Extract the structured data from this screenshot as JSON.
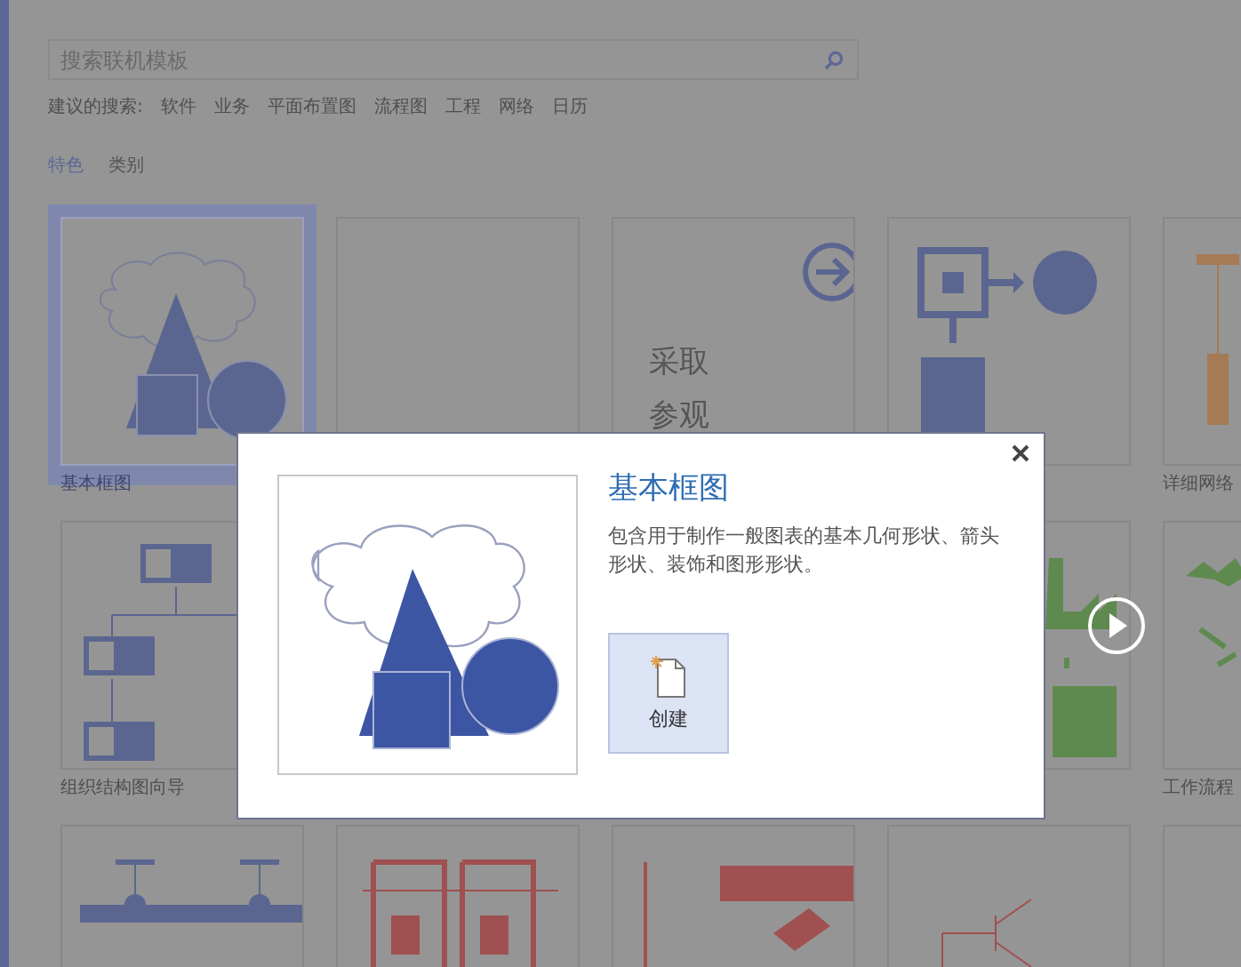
{
  "search": {
    "placeholder": "搜索联机模板"
  },
  "suggested": {
    "label": "建议的搜索:",
    "items": [
      "软件",
      "业务",
      "平面布置图",
      "流程图",
      "工程",
      "网络",
      "日历"
    ]
  },
  "category_tabs": [
    {
      "label": "特色",
      "selected": true
    },
    {
      "label": "类别",
      "selected": false
    }
  ],
  "templates": [
    {
      "kind": "basic",
      "label": "基本框图",
      "selected": true
    },
    {
      "kind": "blank",
      "selected": false
    },
    {
      "kind": "tour",
      "lines": [
        "采取",
        "参观"
      ],
      "selected": false
    },
    {
      "kind": "block",
      "selected": false
    },
    {
      "kind": "network",
      "label": "详细网络",
      "selected": false
    },
    {
      "kind": "org",
      "label": "组织结构图向导",
      "selected": false
    },
    {
      "kind": "covered"
    },
    {
      "kind": "covered"
    },
    {
      "kind": "factory",
      "selected": false
    },
    {
      "kind": "workflow",
      "label": "工作流程",
      "selected": false
    },
    {
      "kind": "bus",
      "selected": false
    },
    {
      "kind": "plan",
      "selected": false
    },
    {
      "kind": "office",
      "selected": false
    },
    {
      "kind": "circuit",
      "selected": false
    },
    {
      "kind": "blank",
      "selected": false
    }
  ],
  "dialog": {
    "title": "基本框图",
    "description": "包含用于制作一般图表的基本几何形状、箭头形状、装饰和图形形状。",
    "create_label": "创建"
  }
}
